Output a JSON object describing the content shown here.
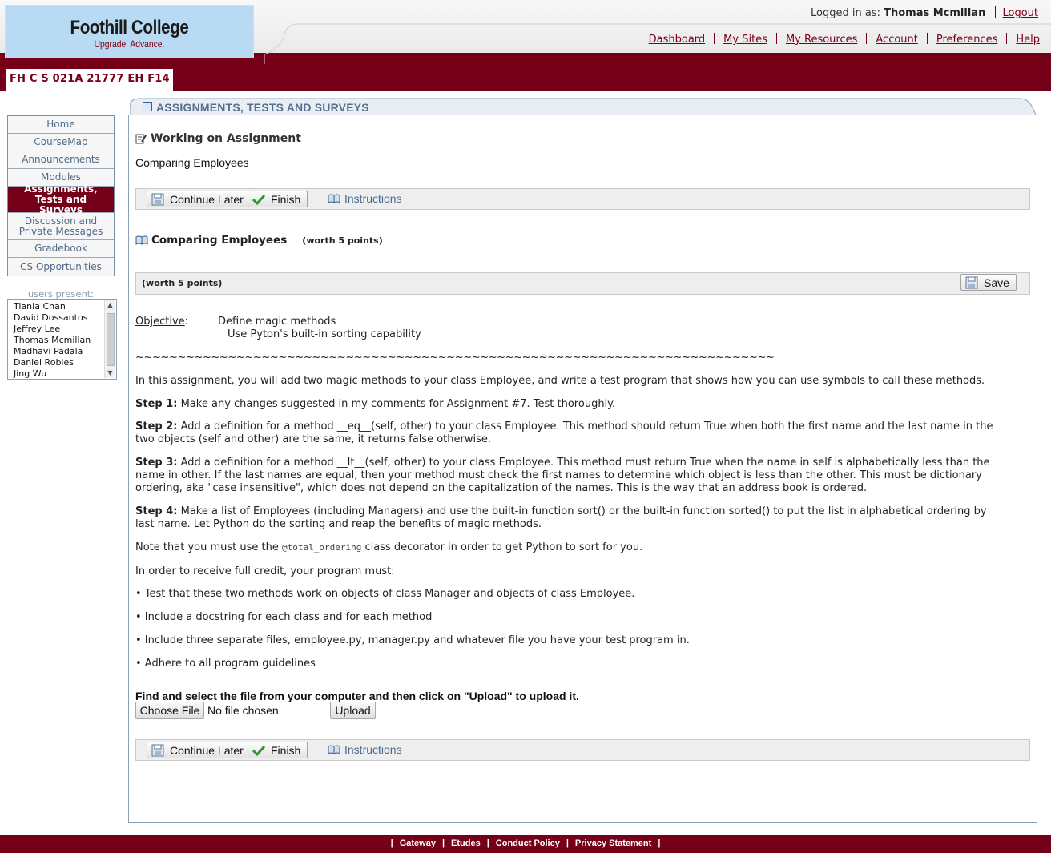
{
  "header": {
    "logo_name": "Foothill College",
    "logo_tagline": "Upgrade. Advance.",
    "logged_in_label": "Logged in as:",
    "user_name": "Thomas Mcmillan",
    "logout": "Logout",
    "nav": [
      "Dashboard",
      "My Sites",
      "My Resources",
      "Account",
      "Preferences",
      "Help"
    ]
  },
  "site_tab": "FH C S 021A 21777 EH F14",
  "toolmenu": {
    "items": [
      {
        "label": "Home"
      },
      {
        "label": "CourseMap"
      },
      {
        "label": "Announcements"
      },
      {
        "label": "Modules"
      },
      {
        "label": "Assignments, Tests and Surveys",
        "active": true
      },
      {
        "label": "Discussion and Private Messages"
      },
      {
        "label": "Gradebook"
      },
      {
        "label": "CS Opportunities"
      }
    ]
  },
  "users_present": {
    "label": "users present:",
    "names": [
      "Tiania Chan",
      "David Dossantos",
      "Jeffrey Lee",
      "Thomas Mcmillan",
      "Madhavi Padala",
      "Daniel Robles",
      "Jing Wu"
    ]
  },
  "tool_title": "ASSIGNMENTS, TESTS AND SURVEYS",
  "working_heading": "Working on Assignment",
  "assignment_name": "Comparing Employees",
  "actions": {
    "continue_later": "Continue Later",
    "finish": "Finish",
    "instructions": "Instructions"
  },
  "question": {
    "title": "Comparing Employees",
    "worth": "(worth 5 points)",
    "bar_worth": "(worth 5 points)",
    "save": "Save"
  },
  "content": {
    "objective_label": "Objective",
    "objective_colon": ":",
    "objective_1": "Define magic methods",
    "objective_2": "Use Pyton's built-in sorting capability",
    "rule": "~~~~~~~~~~~~~~~~~~~~~~~~~~~~~~~~~~~~~~~~~~~~~~~~~~~~~~~~~~~~~~~~~~~~~~~~~~~~",
    "intro": "In this assignment, you will add two magic methods to your class Employee, and write a test program that shows how you can use symbols to call these methods.",
    "step1_label": "Step 1:",
    "step1": " Make any changes suggested in my comments for Assignment #7. Test thoroughly.",
    "step2_label": "Step 2:",
    "step2": " Add a definition for a method __eq__(self, other) to your class Employee. This method should return True when both the first name and the last name in the two objects (self and other) are the same, it returns false otherwise.",
    "step3_label": "Step 3:",
    "step3": " Add a definition for a method __lt__(self, other) to your class Employee. This method must return True when the name in self is alphabetically less than the name in other. If the last names are equal, then your method must check the first names to determine which object is less than the other. This must be dictionary ordering, aka \"case insensitive\", which does not depend on the capitalization of the names. This is the way that an address book is ordered.",
    "step4_label": "Step 4:",
    "step4": " Make a list of Employees (including Managers) and use the built-in function sort() or the built-in function sorted() to put the list in alphabetical ordering by last name. Let Python do the sorting and reap the benefits of magic methods.",
    "note_pre": "Note that you must use the ",
    "note_code": "@total_ordering",
    "note_post": " class decorator in order to get Python to sort for you.",
    "credit": "In order to receive full credit, your program must:",
    "bullets": [
      "• Test that these two methods work on objects of class Manager and objects of class Employee.",
      "• Include a docstring for each class and for each method",
      "• Include three separate files, employee.py, manager.py and whatever file you have your test program in.",
      "• Adhere to all program guidelines"
    ]
  },
  "upload": {
    "prompt": "Find and select the file from your computer and then click on \"Upload\" to upload it.",
    "choose_file": "Choose File",
    "no_file": "No file chosen",
    "upload": "Upload"
  },
  "footer": {
    "links": [
      "Gateway",
      "Etudes",
      "Conduct Policy",
      "Privacy Statement"
    ]
  },
  "colors": {
    "maroon": "#760018",
    "link_blue": "#4a6b8f"
  }
}
